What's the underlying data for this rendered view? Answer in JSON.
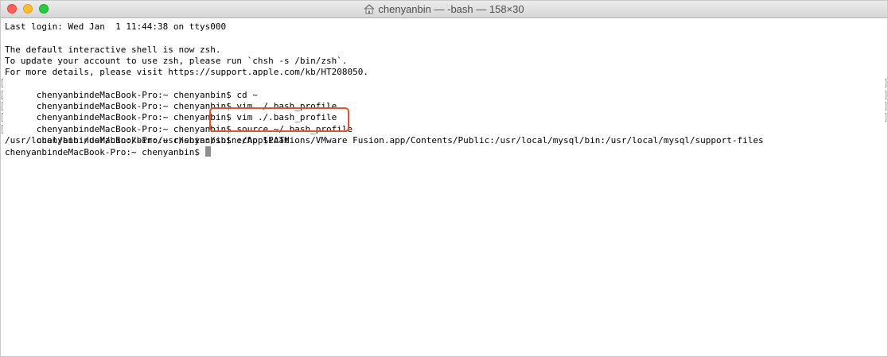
{
  "window": {
    "title": "chenyanbin — -bash — 158×30",
    "title_icon": "home-folder-icon"
  },
  "terminal": {
    "lines": [
      "Last login: Wed Jan  1 11:44:38 on ttys000",
      "",
      "The default interactive shell is now zsh.",
      "To update your account to use zsh, please run `chsh -s /bin/zsh`.",
      "For more details, please visit https://support.apple.com/kb/HT208050.",
      "chenyanbindeMacBook-Pro:~ chenyanbin$ cd ~",
      "chenyanbindeMacBook-Pro:~ chenyanbin$ vim ./.bash_profile",
      "chenyanbindeMacBook-Pro:~ chenyanbin$ vim ./.bash_profile",
      "chenyanbindeMacBook-Pro:~ chenyanbin$ source ~/.bash_profile",
      "chenyanbindeMacBook-Pro:~ chenyanbin$ echo $PATH",
      "/usr/local/bin:/usr/bin:/bin:/usr/sbin:/sbin:/Applications/VMware Fusion.app/Contents/Public:/usr/local/mysql/bin:/usr/local/mysql/support-files",
      "chenyanbindeMacBook-Pro:~ chenyanbin$ "
    ]
  },
  "colors": {
    "highlight_border": "#e5532d",
    "cursor": "#8e8e8e",
    "close": "#fc5f57",
    "minimize": "#fdbc2e",
    "maximize": "#28c840"
  }
}
